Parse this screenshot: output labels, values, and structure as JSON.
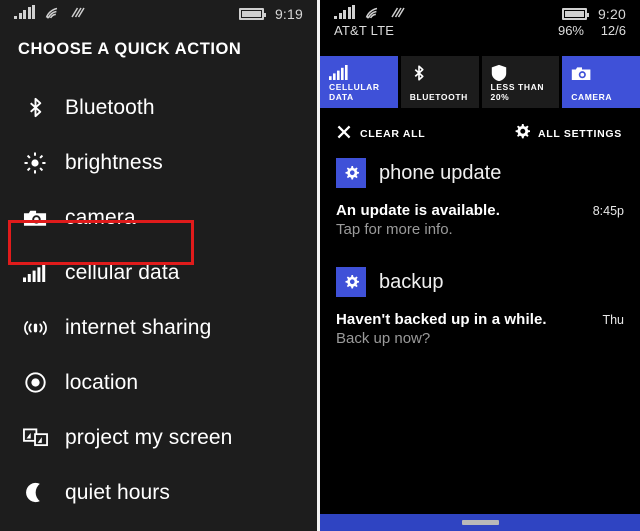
{
  "left": {
    "statusbar": {
      "icons": [
        "signal-bars-icon",
        "wifi-icon",
        "data-sync-icon",
        "battery-icon"
      ],
      "time": "9:19"
    },
    "title": "CHOOSE A QUICK ACTION",
    "items": [
      {
        "label": "Bluetooth",
        "icon": "bluetooth-icon"
      },
      {
        "label": "brightness",
        "icon": "brightness-icon"
      },
      {
        "label": "camera",
        "icon": "camera-icon"
      },
      {
        "label": "cellular data",
        "icon": "cellular-data-icon",
        "highlighted": true
      },
      {
        "label": "internet sharing",
        "icon": "internet-sharing-icon"
      },
      {
        "label": "location",
        "icon": "location-icon"
      },
      {
        "label": "project my screen",
        "icon": "project-screen-icon"
      },
      {
        "label": "quiet hours",
        "icon": "moon-icon"
      }
    ],
    "highlight_color": "#e01b1b"
  },
  "right": {
    "statusbar": {
      "icons": [
        "signal-bars-icon",
        "wifi-icon",
        "data-sync-icon",
        "battery-icon"
      ],
      "carrier": "AT&T LTE",
      "battery_percent": "96%",
      "time": "9:20",
      "date": "12/6"
    },
    "tiles": [
      {
        "label": "CELLULAR DATA",
        "icon": "cellular-data-icon",
        "active": true
      },
      {
        "label": "BLUETOOTH",
        "icon": "bluetooth-icon",
        "active": false
      },
      {
        "label": "LESS THAN 20%",
        "icon": "shield-icon",
        "active": false
      },
      {
        "label": "CAMERA",
        "icon": "camera-icon",
        "active": true
      }
    ],
    "actions": {
      "clear_all": "CLEAR ALL",
      "all_settings": "ALL SETTINGS"
    },
    "notifications": [
      {
        "app": "phone update",
        "app_icon": "gear-icon",
        "title": "An update is available.",
        "subtitle": "Tap for more info.",
        "time": "8:45p"
      },
      {
        "app": "backup",
        "app_icon": "gear-icon",
        "title": "Haven't backed up in a while.",
        "subtitle": "Back up now?",
        "time": "Thu"
      }
    ],
    "accent_color": "#3f51d8",
    "navbar_color": "#2f44c2"
  }
}
